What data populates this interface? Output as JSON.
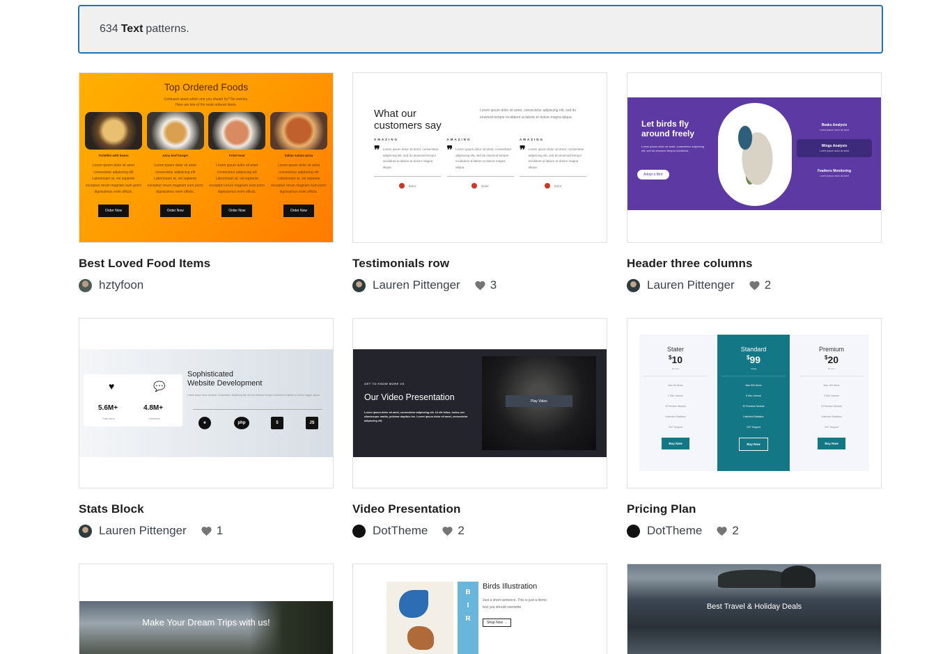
{
  "search": {
    "count": "634",
    "category": "Text",
    "suffix": "patterns."
  },
  "cards": [
    {
      "title": "Best Loved Food Items",
      "author": "hztyfoon",
      "likes": "",
      "thumb": {
        "heading": "Top Ordered Foods",
        "sub1": "Confused about which one you should try? No worries.",
        "sub2": "Here are few of the most ordered items.",
        "items": [
          {
            "name": "Tortellini with beans",
            "button": "Order Now"
          },
          {
            "name": "Juicy beef burger",
            "button": "Order Now"
          },
          {
            "name": "Fried meat",
            "button": "Order Now"
          },
          {
            "name": "Italian salami pizza",
            "button": "Order Now"
          }
        ],
        "body": "Lorem ipsum dolor sit amet consectetur adipiscing elit Laboriosam at, vel sapiente excepturi rerum magnam eum porro dignissimos enim officiis."
      }
    },
    {
      "title": "Testimonials row",
      "author": "Lauren Pittenger",
      "likes": "3",
      "thumb": {
        "heading_line1": "What our",
        "heading_line2": "customers say",
        "intro": "Lorem ipsum dolor sit amet, consectetur adipiscing elit, sed do eiusmod tempor incididunt ut labore et dolore magna aliqua.",
        "label": "AMAZING",
        "quote": "Lorem ipsum dolor sit amet, consectetur adipiscing elit, sed do eiusmod tempor incididunt ut labore et dolore magna aliqua.",
        "author": "Dolor"
      }
    },
    {
      "title": "Header three columns",
      "author": "Lauren Pittenger",
      "likes": "2",
      "thumb": {
        "heading_line1": "Let birds fly",
        "heading_line2": "around freely",
        "text": "Lorem ipsum dolor sit amet, consectetur adipiscing elit, sed do eiusmod tempor incididunt.",
        "button": "Adopt a Bird",
        "cols": [
          {
            "title": "Beaks Analysis",
            "sub": "Lorem ipsum dolor sit amet"
          },
          {
            "title": "Wings Analysis",
            "sub": "Lorem ipsum dolor sit amet"
          },
          {
            "title": "Feathers Monitoring",
            "sub": "Lorem ipsum dolor sit amet"
          }
        ]
      }
    },
    {
      "title": "Stats Block",
      "author": "Lauren Pittenger",
      "likes": "1",
      "thumb": {
        "stat1": "5.6M+",
        "stat1_label": "Total Users",
        "stat2": "4.8M+",
        "stat2_label": "Comments",
        "heading_line1": "Sophisticated",
        "heading_line2": "Website Development",
        "text": "Lorem ipsum dolor sit amet, consectetur adipiscing elit, sed do eiusmod tempor incididunt ut labore et dolore magna aliqua."
      }
    },
    {
      "title": "Video Presentation",
      "author": "DotTheme",
      "likes": "2",
      "thumb": {
        "kicker": "GET TO KNOW MORE US",
        "heading": "Our Video Presentation",
        "text": "Lorem ipsum dolor sit amet, consectetur adipiscing elit. Ut elit tellus, luctus nec ullamcorper mattis, pulvinar dapibus leo. Lorem ipsum dolor sit amet, consectetur adipiscing elit.",
        "button": "Play Video"
      }
    },
    {
      "title": "Pricing Plan",
      "author": "DotTheme",
      "likes": "2",
      "thumb": {
        "plans": [
          {
            "name": "Stater",
            "price": "10",
            "period": "Monthly",
            "features": [
              "Max 50 Items",
              "1 Site License",
              "5 Premium Module",
              "Unlimited Statistics",
              "24/7 Support"
            ],
            "button": "Buy Now"
          },
          {
            "name": "Standard",
            "price": "99",
            "period": "Yearly",
            "features": [
              "Max 500 Items",
              "5 Site License",
              "20 Premium Module",
              "Unlimited Statistics",
              "24/7 Support"
            ],
            "button": "Buy Now"
          },
          {
            "name": "Premium",
            "price": "20",
            "period": "Monthly",
            "features": [
              "Max 100 Items",
              "3 Site License",
              "8 Premium Module",
              "Unlimited Statistics",
              "24/7 Support"
            ],
            "button": "Buy Now"
          }
        ]
      }
    },
    {
      "title": "",
      "author": "",
      "likes": "",
      "thumb": {
        "heading": "Make Your Dream Trips with us!"
      }
    },
    {
      "title": "",
      "author": "",
      "likes": "",
      "thumb": {
        "heading": "Birds Illustration",
        "text": "Just a short sentence. This is just a demo text you should overwrite.",
        "button": "Shop Now →",
        "stripe": "BIR"
      }
    },
    {
      "title": "",
      "author": "",
      "likes": "",
      "thumb": {
        "heading": "Best Travel & Holiday Deals"
      }
    }
  ],
  "colors": {
    "accent": "#2271b1",
    "heart": "#757575"
  },
  "icons": {
    "like": "heart-icon",
    "avatar": "avatar"
  }
}
